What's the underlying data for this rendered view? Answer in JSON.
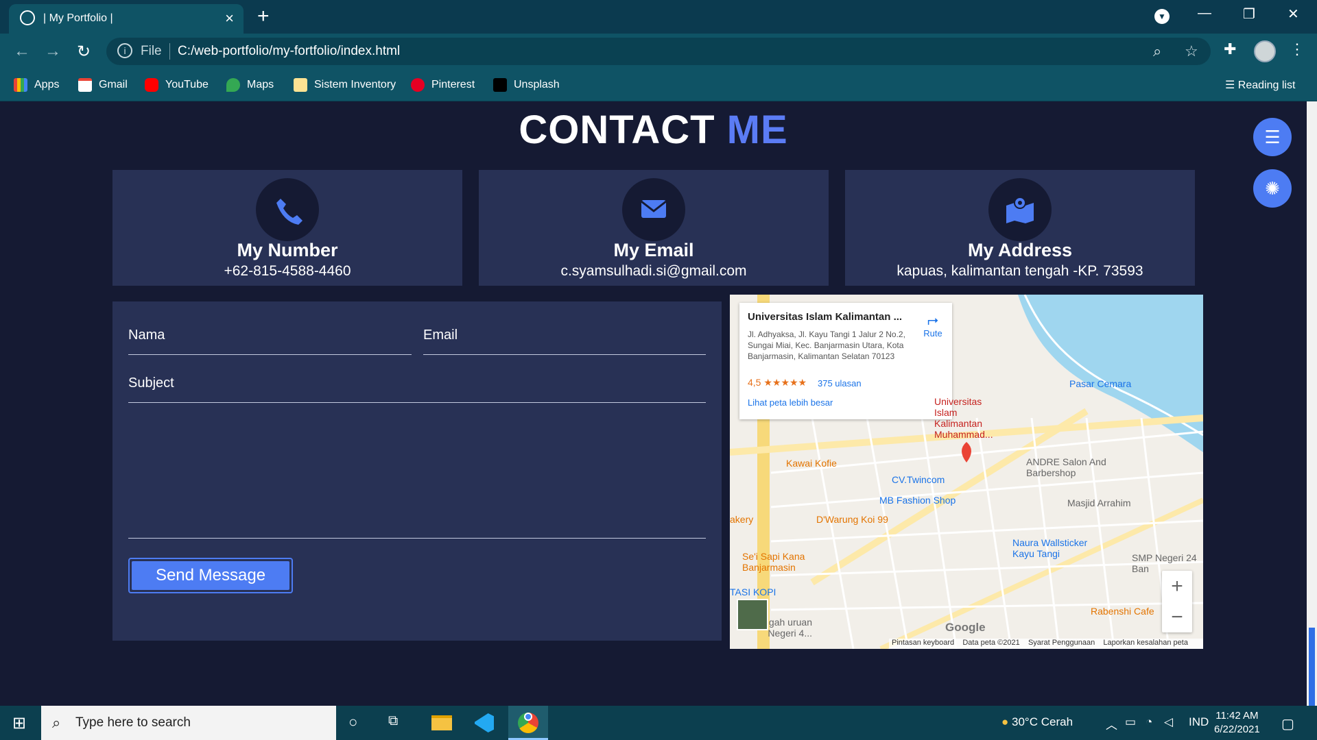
{
  "browser": {
    "tab_title": "| My Portfolio |",
    "url_scheme": "File",
    "url": "C:/web-portfolio/my-fortfolio/index.html",
    "bookmarks": [
      "Apps",
      "Gmail",
      "YouTube",
      "Maps",
      "Sistem Inventory",
      "Pinterest",
      "Unsplash"
    ],
    "reading_list": "Reading list"
  },
  "page": {
    "heading_main": "CONTACT",
    "heading_accent": "ME",
    "cards": [
      {
        "title": "My Number",
        "value": "+62-815-4588-4460",
        "icon": "phone-icon"
      },
      {
        "title": "My Email",
        "value": "c.syamsulhadi.si@gmail.com",
        "icon": "envelope-icon"
      },
      {
        "title": "My Address",
        "value": "kapuas, kalimantan tengah -KP. 73593",
        "icon": "map-icon"
      }
    ],
    "form": {
      "name_placeholder": "Nama",
      "email_placeholder": "Email",
      "subject_placeholder": "Subject",
      "send_label": "Send Message"
    },
    "accent_color": "#4d7cf3"
  },
  "map": {
    "place_name": "Universitas Islam Kalimantan ...",
    "address": "Jl. Adhyaksa, Jl. Kayu Tangi 1 Jalur 2 No.2, Sungai Miai, Kec. Banjarmasin Utara, Kota Banjarmasin, Kalimantan Selatan 70123",
    "rating": "4,5 ★★★★★",
    "reviews": "375 ulasan",
    "larger_map": "Lihat peta lebih besar",
    "route": "Rute",
    "labels": {
      "pasar_cemara": "Pasar Cemara",
      "univ": "Universitas Islam Kalimantan Muhammad...",
      "kawai": "Kawai Kofie",
      "twincom": "CV.Twincom",
      "andre": "ANDRE Salon And Barbershop",
      "mb": "MB Fashion Shop",
      "masjid": "Masjid Arrahim",
      "dwarung": "D'Warung Koi 99",
      "naura": "Naura Wallsticker Kayu Tangi",
      "sapi": "Se'i Sapi Kana Banjarmasin",
      "smp": "SMP Negeri 24 Ban",
      "kopi": "TASI KOPI",
      "rabenshi": "Rabenshi Cafe",
      "kery": "akery",
      "negeri": "nengah uruan Negeri 4...",
      "google": "Google"
    },
    "footer": [
      "Pintasan keyboard",
      "Data peta ©2021",
      "Syarat Penggunaan",
      "Laporkan kesalahan peta"
    ]
  },
  "taskbar": {
    "search_placeholder": "Type here to search",
    "weather": "30°C  Cerah",
    "lang": "IND",
    "time": "11:42 AM",
    "date": "6/22/2021"
  }
}
